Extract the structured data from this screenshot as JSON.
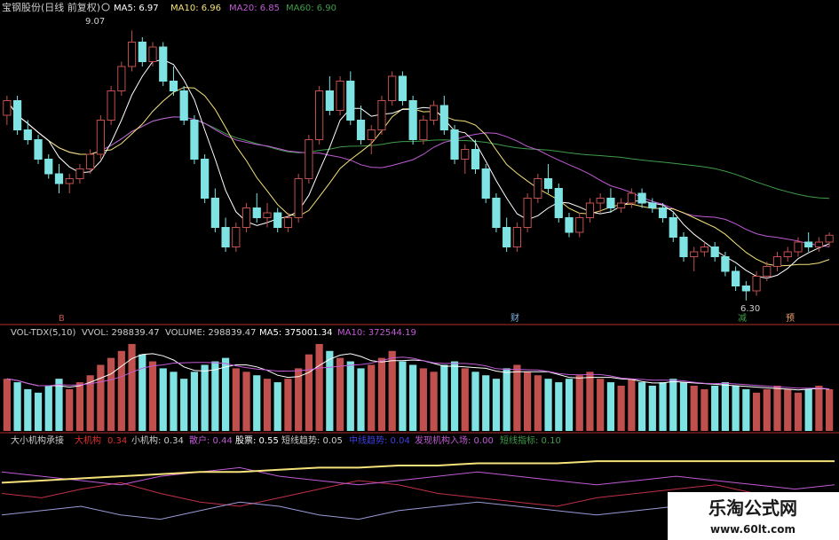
{
  "colors": {
    "background": "#000000",
    "up": "#c0504d",
    "down": "#7fe3e3",
    "ma5": "#ffffff",
    "ma10": "#f5e27a",
    "ma20": "#c25bd6",
    "ma60": "#3f9d4a",
    "divider": "#b0302a",
    "label": "#cfcfcf",
    "series_volume_ma5": "#ffffff",
    "series_volume_ma10": "#c25bd6"
  },
  "header": {
    "title": "宝钢股份(日线 前复权)",
    "ma5_label": "MA5: 6.97",
    "ma10_label": "MA10: 6.96",
    "ma20_label": "MA20: 6.85",
    "ma60_label": "MA60: 6.90"
  },
  "price_annotations": {
    "high_label": "9.07",
    "low_label": "6.30",
    "marker_left": "B",
    "marker_cai": "财",
    "marker_jian": "减",
    "marker_yu": "预"
  },
  "volume_header": {
    "indicator": "VOL-TDX(5,10)",
    "vvol": "VVOL: 298839.47",
    "volume": "VOLUME: 298839.47",
    "ma5": "MA5: 375001.34",
    "ma10": "MA10: 372544.19"
  },
  "indicator_header": {
    "name": "大小机构承接",
    "big_label": "大机构",
    "big_value": "0.34",
    "small": "小机构: 0.34",
    "retail": "散户: 0.44",
    "stock": "股票: 0.55",
    "short_trend": "短线趋势: 0.05",
    "mid_trend": "中线趋势: 0.04",
    "discover": "发现机构入场: 0.00",
    "short_index": "短线指标: 0.10"
  },
  "watermark": {
    "cn": "乐淘公式网",
    "url": "www.60lt.com"
  },
  "chart_data": [
    {
      "type": "candlestick",
      "title": "宝钢股份(日线 前复权)",
      "ylim": [
        6.2,
        9.2
      ],
      "candles": [
        [
          8.2,
          8.4,
          8.1,
          8.35
        ],
        [
          8.35,
          8.4,
          8.0,
          8.05
        ],
        [
          8.05,
          8.15,
          7.9,
          7.95
        ],
        [
          7.95,
          8.0,
          7.7,
          7.75
        ],
        [
          7.75,
          7.8,
          7.55,
          7.6
        ],
        [
          7.6,
          7.7,
          7.4,
          7.5
        ],
        [
          7.5,
          7.6,
          7.4,
          7.55
        ],
        [
          7.55,
          7.7,
          7.5,
          7.65
        ],
        [
          7.65,
          7.85,
          7.6,
          7.8
        ],
        [
          7.8,
          8.2,
          7.75,
          8.15
        ],
        [
          8.15,
          8.5,
          8.1,
          8.45
        ],
        [
          8.45,
          8.75,
          8.4,
          8.7
        ],
        [
          8.7,
          9.07,
          8.65,
          8.95
        ],
        [
          8.95,
          9.0,
          8.7,
          8.75
        ],
        [
          8.75,
          8.95,
          8.7,
          8.9
        ],
        [
          8.9,
          8.95,
          8.5,
          8.55
        ],
        [
          8.55,
          8.7,
          8.4,
          8.45
        ],
        [
          8.45,
          8.5,
          8.1,
          8.15
        ],
        [
          8.15,
          8.2,
          7.7,
          7.75
        ],
        [
          7.75,
          7.8,
          7.3,
          7.35
        ],
        [
          7.35,
          7.45,
          7.0,
          7.05
        ],
        [
          7.05,
          7.15,
          6.8,
          6.85
        ],
        [
          6.85,
          7.1,
          6.8,
          7.05
        ],
        [
          7.05,
          7.3,
          7.0,
          7.25
        ],
        [
          7.25,
          7.4,
          7.1,
          7.15
        ],
        [
          7.15,
          7.3,
          7.05,
          7.2
        ],
        [
          7.2,
          7.25,
          7.0,
          7.05
        ],
        [
          7.05,
          7.2,
          7.0,
          7.15
        ],
        [
          7.15,
          7.6,
          7.1,
          7.55
        ],
        [
          7.55,
          8.0,
          7.5,
          7.95
        ],
        [
          7.95,
          8.5,
          7.9,
          8.45
        ],
        [
          8.45,
          8.6,
          8.2,
          8.25
        ],
        [
          8.25,
          8.6,
          8.2,
          8.55
        ],
        [
          8.55,
          8.65,
          8.1,
          8.15
        ],
        [
          8.15,
          8.3,
          7.9,
          7.95
        ],
        [
          7.95,
          8.1,
          7.8,
          8.05
        ],
        [
          8.05,
          8.4,
          8.0,
          8.35
        ],
        [
          8.35,
          8.65,
          8.3,
          8.6
        ],
        [
          8.6,
          8.65,
          8.3,
          8.35
        ],
        [
          8.35,
          8.4,
          7.9,
          7.95
        ],
        [
          7.95,
          8.2,
          7.9,
          8.15
        ],
        [
          8.15,
          8.35,
          8.1,
          8.3
        ],
        [
          8.3,
          8.4,
          8.0,
          8.05
        ],
        [
          8.05,
          8.1,
          7.7,
          7.75
        ],
        [
          7.75,
          7.9,
          7.6,
          7.85
        ],
        [
          7.85,
          7.95,
          7.6,
          7.65
        ],
        [
          7.65,
          7.7,
          7.3,
          7.35
        ],
        [
          7.35,
          7.4,
          7.0,
          7.05
        ],
        [
          7.05,
          7.15,
          6.8,
          6.85
        ],
        [
          6.85,
          7.1,
          6.8,
          7.05
        ],
        [
          7.05,
          7.4,
          7.0,
          7.35
        ],
        [
          7.35,
          7.6,
          7.3,
          7.55
        ],
        [
          7.55,
          7.7,
          7.4,
          7.45
        ],
        [
          7.45,
          7.5,
          7.1,
          7.15
        ],
        [
          7.15,
          7.2,
          6.95,
          7.0
        ],
        [
          7.0,
          7.2,
          6.95,
          7.15
        ],
        [
          7.15,
          7.35,
          7.1,
          7.3
        ],
        [
          7.3,
          7.4,
          7.2,
          7.35
        ],
        [
          7.35,
          7.45,
          7.2,
          7.25
        ],
        [
          7.25,
          7.35,
          7.2,
          7.3
        ],
        [
          7.3,
          7.45,
          7.25,
          7.4
        ],
        [
          7.4,
          7.45,
          7.25,
          7.3
        ],
        [
          7.3,
          7.35,
          7.2,
          7.25
        ],
        [
          7.25,
          7.3,
          7.1,
          7.15
        ],
        [
          7.15,
          7.2,
          6.9,
          6.95
        ],
        [
          6.95,
          7.0,
          6.7,
          6.75
        ],
        [
          6.75,
          6.85,
          6.6,
          6.8
        ],
        [
          6.8,
          6.9,
          6.75,
          6.85
        ],
        [
          6.85,
          6.9,
          6.7,
          6.75
        ],
        [
          6.75,
          6.8,
          6.55,
          6.6
        ],
        [
          6.6,
          6.65,
          6.4,
          6.45
        ],
        [
          6.45,
          6.5,
          6.3,
          6.4
        ],
        [
          6.4,
          6.6,
          6.35,
          6.55
        ],
        [
          6.55,
          6.7,
          6.5,
          6.65
        ],
        [
          6.65,
          6.8,
          6.6,
          6.75
        ],
        [
          6.75,
          6.85,
          6.7,
          6.8
        ],
        [
          6.8,
          6.95,
          6.75,
          6.9
        ],
        [
          6.9,
          7.0,
          6.8,
          6.85
        ],
        [
          6.85,
          6.95,
          6.8,
          6.9
        ],
        [
          6.9,
          7.0,
          6.85,
          6.97
        ]
      ]
    },
    {
      "type": "bar",
      "title": "VOL-TDX(5,10)",
      "values": [
        30,
        28,
        24,
        22,
        26,
        30,
        24,
        28,
        32,
        38,
        42,
        46,
        50,
        44,
        40,
        36,
        34,
        30,
        34,
        38,
        40,
        42,
        36,
        34,
        32,
        30,
        28,
        30,
        36,
        44,
        50,
        46,
        42,
        40,
        36,
        38,
        42,
        46,
        40,
        38,
        36,
        34,
        38,
        40,
        36,
        34,
        32,
        30,
        36,
        38,
        34,
        32,
        30,
        28,
        30,
        32,
        34,
        30,
        28,
        26,
        30,
        28,
        26,
        28,
        30,
        28,
        26,
        24,
        26,
        28,
        26,
        24,
        22,
        24,
        26,
        24,
        22,
        24,
        26,
        24
      ]
    },
    {
      "type": "line",
      "title": "大小机构承接",
      "series": [
        {
          "name": "大机构",
          "values": [
            0.4,
            0.38,
            0.42,
            0.45,
            0.4,
            0.36,
            0.34,
            0.38,
            0.42,
            0.46,
            0.44,
            0.4,
            0.38,
            0.36,
            0.34,
            0.38,
            0.4,
            0.42,
            0.44,
            0.4,
            0.38,
            0.34
          ]
        },
        {
          "name": "小机构",
          "values": [
            0.3,
            0.32,
            0.34,
            0.3,
            0.28,
            0.32,
            0.36,
            0.34,
            0.3,
            0.28,
            0.32,
            0.34,
            0.36,
            0.34,
            0.32,
            0.3,
            0.32,
            0.34,
            0.36,
            0.34,
            0.32,
            0.34
          ]
        },
        {
          "name": "散户",
          "values": [
            0.5,
            0.48,
            0.46,
            0.44,
            0.48,
            0.5,
            0.52,
            0.48,
            0.46,
            0.44,
            0.46,
            0.48,
            0.5,
            0.48,
            0.46,
            0.44,
            0.46,
            0.48,
            0.46,
            0.44,
            0.42,
            0.44
          ]
        },
        {
          "name": "股票",
          "values": [
            0.45,
            0.46,
            0.47,
            0.48,
            0.49,
            0.5,
            0.5,
            0.51,
            0.52,
            0.52,
            0.53,
            0.53,
            0.54,
            0.54,
            0.54,
            0.55,
            0.55,
            0.55,
            0.55,
            0.55,
            0.55,
            0.55
          ]
        }
      ]
    }
  ]
}
